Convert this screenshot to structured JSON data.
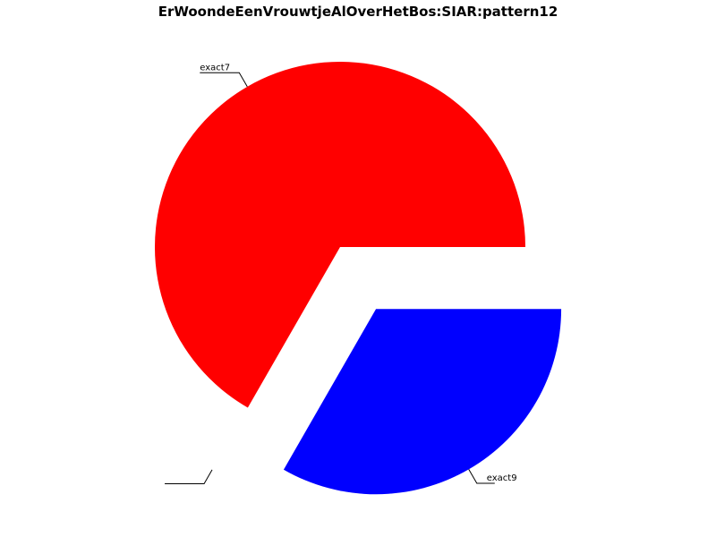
{
  "chart_data": {
    "type": "pie",
    "title": "ErWoondeEenVrouwtjeAlOverHetBos:SIAR:pattern12",
    "slices": [
      {
        "label": "exact7",
        "value": 66.7,
        "color": "#ff0000",
        "explode": false
      },
      {
        "label": "",
        "value": 0.0,
        "color": "#00ff00",
        "explode": true
      },
      {
        "label": "exact9",
        "value": 33.3,
        "color": "#0000ff",
        "explode": true
      }
    ],
    "start_angle_deg": 0,
    "direction": "counterclockwise"
  }
}
